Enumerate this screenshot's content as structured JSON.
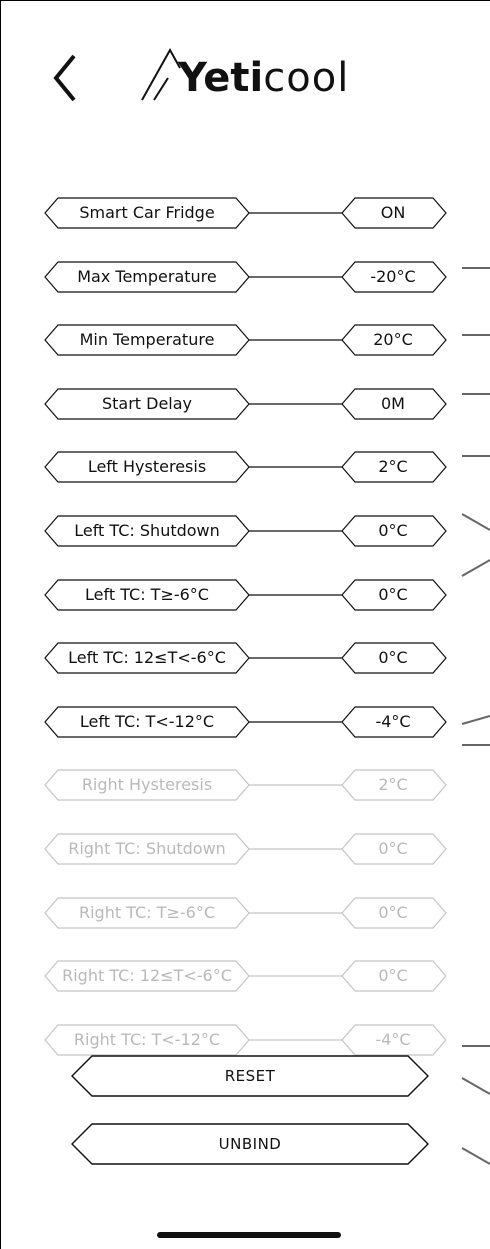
{
  "header": {
    "back_icon": "chevron-left-icon",
    "brand": {
      "bold": "Yeti",
      "light": "cool"
    }
  },
  "colors": {
    "text_active": "#111111",
    "text_disabled": "#b9b9b9",
    "stroke_active": "#111111",
    "stroke_disabled": "#c4c4c4",
    "background": "#ffffff"
  },
  "settings": [
    {
      "label": "Smart Car Fridge",
      "value": "ON",
      "enabled": true
    },
    {
      "label": "Max Temperature",
      "value": "-20°C",
      "enabled": true
    },
    {
      "label": "Min Temperature",
      "value": "20°C",
      "enabled": true
    },
    {
      "label": "Start Delay",
      "value": "0M",
      "enabled": true
    },
    {
      "label": "Left Hysteresis",
      "value": "2°C",
      "enabled": true
    },
    {
      "label": "Left TC: Shutdown",
      "value": "0°C",
      "enabled": true
    },
    {
      "label": "Left TC: T≥-6°C",
      "value": "0°C",
      "enabled": true
    },
    {
      "label": "Left TC: 12≤T<-6°C",
      "value": "0°C",
      "enabled": true
    },
    {
      "label": "Left TC: T<-12°C",
      "value": "-4°C",
      "enabled": true
    },
    {
      "label": "Right Hysteresis",
      "value": "2°C",
      "enabled": false
    },
    {
      "label": "Right TC: Shutdown",
      "value": "0°C",
      "enabled": false
    },
    {
      "label": "Right TC: T≥-6°C",
      "value": "0°C",
      "enabled": false
    },
    {
      "label": "Right TC: 12≤T<-6°C",
      "value": "0°C",
      "enabled": false
    },
    {
      "label": "Right TC: T<-12°C",
      "value": "-4°C",
      "enabled": false
    }
  ],
  "actions": {
    "reset_label": "RESET",
    "unbind_label": "UNBIND"
  }
}
